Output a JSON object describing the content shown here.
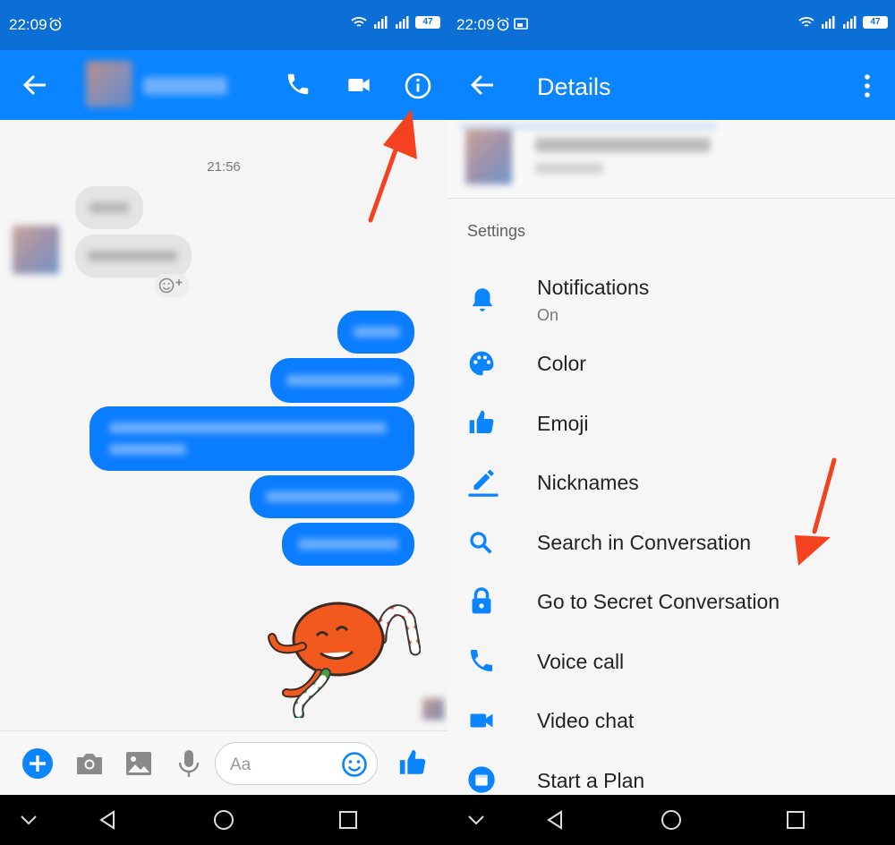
{
  "left_screen": {
    "status": {
      "time": "22:09",
      "battery": "47"
    },
    "chat": {
      "timestamp": "21:56"
    },
    "composer": {
      "placeholder": "Aa"
    }
  },
  "right_screen": {
    "status": {
      "time": "22:09",
      "battery": "47"
    },
    "header": {
      "title": "Details"
    },
    "settings": {
      "heading": "Settings",
      "items": [
        {
          "label": "Notifications",
          "sublabel": "On",
          "icon": "bell-icon"
        },
        {
          "label": "Color",
          "icon": "palette-icon"
        },
        {
          "label": "Emoji",
          "icon": "thumbs-up-icon"
        },
        {
          "label": "Nicknames",
          "icon": "pencil-icon"
        },
        {
          "label": "Search in Conversation",
          "icon": "search-icon"
        },
        {
          "label": "Go to Secret Conversation",
          "icon": "lock-icon"
        },
        {
          "label": "Voice call",
          "icon": "phone-icon"
        },
        {
          "label": "Video chat",
          "icon": "video-camera-icon"
        },
        {
          "label": "Start a Plan",
          "icon": "calendar-icon"
        }
      ]
    }
  },
  "colors": {
    "status_bar": "#0b6fd6",
    "app_bar": "#0a84ff",
    "accent": "#0a84ff",
    "arrow": "#f4411f",
    "outgoing_bubble": "#0a7cff"
  }
}
